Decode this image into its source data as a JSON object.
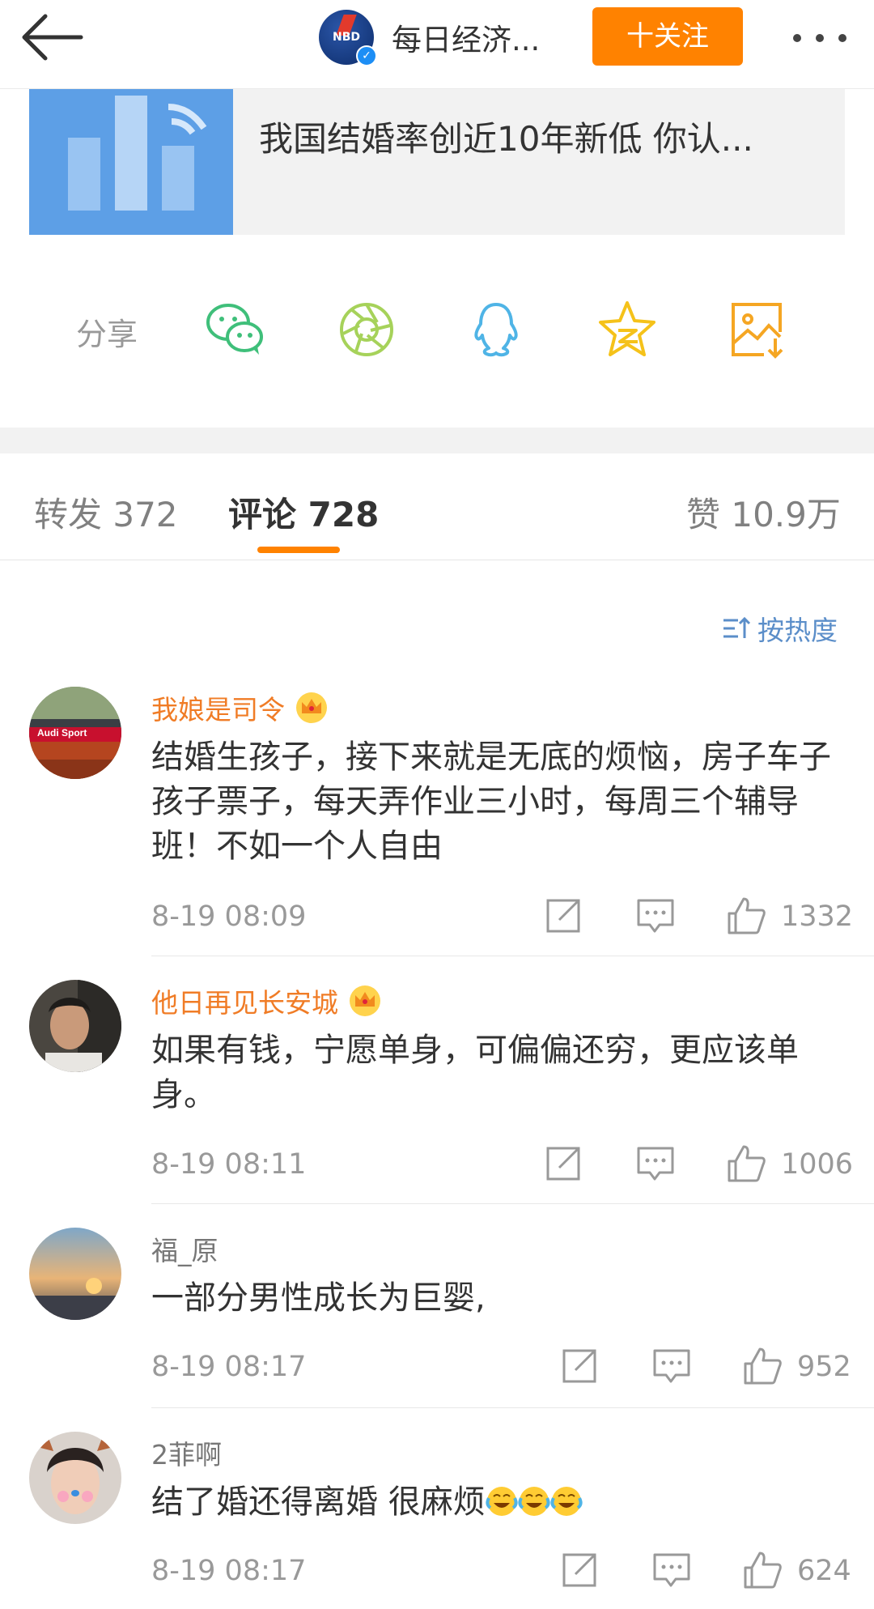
{
  "header": {
    "account_name": "每日经济...",
    "logo_text": "NBD",
    "follow_label": "十关注"
  },
  "article": {
    "title": "我国结婚率创近10年新低 你认..."
  },
  "share": {
    "label": "分享",
    "icons": [
      "wechat-icon",
      "moments-icon",
      "qq-icon",
      "qzone-icon",
      "save-image-icon"
    ],
    "colors": {
      "wechat": "#3fbf7a",
      "moments": "#a6d25a",
      "qq": "#4fb4e6",
      "qzone": "#f5c21a",
      "save": "#f5a623"
    }
  },
  "tabs": {
    "repost": "转发 372",
    "comments": "评论 728",
    "likes": "赞 10.9万"
  },
  "sort_label": "按热度",
  "comments": [
    {
      "name": "我娘是司令",
      "text": "结婚生孩子，接下来就是无底的烦恼，房子车子孩子票子，每天弄作业三小时，每周三个辅导班！不如一个人自由",
      "time": "8-19 08:09",
      "likes": "1332",
      "avatar_text": "Audi Sport"
    },
    {
      "name": "他日再见长安城",
      "text": "如果有钱，宁愿单身，可偏偏还穷，更应该单身。",
      "time": "8-19 08:11",
      "likes": "1006"
    },
    {
      "name": "福_原",
      "text": "一部分男性成长为巨婴,",
      "time": "8-19 08:17",
      "likes": "952"
    },
    {
      "name": "2菲啊",
      "text": "结了婚还得离婚  很麻烦",
      "time": "8-19 08:17",
      "likes": "624"
    }
  ],
  "colors": {
    "accent": "#ff8200",
    "vip_name": "#f07c26",
    "link_blue": "#5b8ec9"
  }
}
